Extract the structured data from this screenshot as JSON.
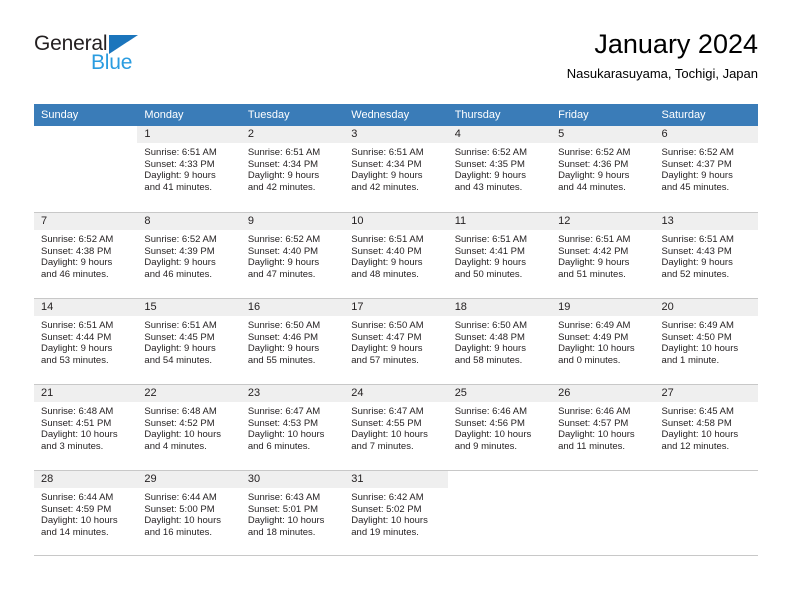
{
  "brand": {
    "name_part1": "General",
    "name_part2": "Blue",
    "triangle_icon": "triangle-icon",
    "color_dark": "#231f20",
    "color_blue": "#2a9ce0",
    "color_triangle": "#1b75bc"
  },
  "header": {
    "title": "January 2024",
    "subtitle": "Nasukarasuyama, Tochigi, Japan"
  },
  "calendar": {
    "header_bg": "#3a7cb8",
    "daynum_bg": "#efefef",
    "weekdays": [
      "Sunday",
      "Monday",
      "Tuesday",
      "Wednesday",
      "Thursday",
      "Friday",
      "Saturday"
    ],
    "weeks": [
      [
        {
          "day": "",
          "lines": []
        },
        {
          "day": "1",
          "lines": [
            "Sunrise: 6:51 AM",
            "Sunset: 4:33 PM",
            "Daylight: 9 hours",
            "and 41 minutes."
          ]
        },
        {
          "day": "2",
          "lines": [
            "Sunrise: 6:51 AM",
            "Sunset: 4:34 PM",
            "Daylight: 9 hours",
            "and 42 minutes."
          ]
        },
        {
          "day": "3",
          "lines": [
            "Sunrise: 6:51 AM",
            "Sunset: 4:34 PM",
            "Daylight: 9 hours",
            "and 42 minutes."
          ]
        },
        {
          "day": "4",
          "lines": [
            "Sunrise: 6:52 AM",
            "Sunset: 4:35 PM",
            "Daylight: 9 hours",
            "and 43 minutes."
          ]
        },
        {
          "day": "5",
          "lines": [
            "Sunrise: 6:52 AM",
            "Sunset: 4:36 PM",
            "Daylight: 9 hours",
            "and 44 minutes."
          ]
        },
        {
          "day": "6",
          "lines": [
            "Sunrise: 6:52 AM",
            "Sunset: 4:37 PM",
            "Daylight: 9 hours",
            "and 45 minutes."
          ]
        }
      ],
      [
        {
          "day": "7",
          "lines": [
            "Sunrise: 6:52 AM",
            "Sunset: 4:38 PM",
            "Daylight: 9 hours",
            "and 46 minutes."
          ]
        },
        {
          "day": "8",
          "lines": [
            "Sunrise: 6:52 AM",
            "Sunset: 4:39 PM",
            "Daylight: 9 hours",
            "and 46 minutes."
          ]
        },
        {
          "day": "9",
          "lines": [
            "Sunrise: 6:52 AM",
            "Sunset: 4:40 PM",
            "Daylight: 9 hours",
            "and 47 minutes."
          ]
        },
        {
          "day": "10",
          "lines": [
            "Sunrise: 6:51 AM",
            "Sunset: 4:40 PM",
            "Daylight: 9 hours",
            "and 48 minutes."
          ]
        },
        {
          "day": "11",
          "lines": [
            "Sunrise: 6:51 AM",
            "Sunset: 4:41 PM",
            "Daylight: 9 hours",
            "and 50 minutes."
          ]
        },
        {
          "day": "12",
          "lines": [
            "Sunrise: 6:51 AM",
            "Sunset: 4:42 PM",
            "Daylight: 9 hours",
            "and 51 minutes."
          ]
        },
        {
          "day": "13",
          "lines": [
            "Sunrise: 6:51 AM",
            "Sunset: 4:43 PM",
            "Daylight: 9 hours",
            "and 52 minutes."
          ]
        }
      ],
      [
        {
          "day": "14",
          "lines": [
            "Sunrise: 6:51 AM",
            "Sunset: 4:44 PM",
            "Daylight: 9 hours",
            "and 53 minutes."
          ]
        },
        {
          "day": "15",
          "lines": [
            "Sunrise: 6:51 AM",
            "Sunset: 4:45 PM",
            "Daylight: 9 hours",
            "and 54 minutes."
          ]
        },
        {
          "day": "16",
          "lines": [
            "Sunrise: 6:50 AM",
            "Sunset: 4:46 PM",
            "Daylight: 9 hours",
            "and 55 minutes."
          ]
        },
        {
          "day": "17",
          "lines": [
            "Sunrise: 6:50 AM",
            "Sunset: 4:47 PM",
            "Daylight: 9 hours",
            "and 57 minutes."
          ]
        },
        {
          "day": "18",
          "lines": [
            "Sunrise: 6:50 AM",
            "Sunset: 4:48 PM",
            "Daylight: 9 hours",
            "and 58 minutes."
          ]
        },
        {
          "day": "19",
          "lines": [
            "Sunrise: 6:49 AM",
            "Sunset: 4:49 PM",
            "Daylight: 10 hours",
            "and 0 minutes."
          ]
        },
        {
          "day": "20",
          "lines": [
            "Sunrise: 6:49 AM",
            "Sunset: 4:50 PM",
            "Daylight: 10 hours",
            "and 1 minute."
          ]
        }
      ],
      [
        {
          "day": "21",
          "lines": [
            "Sunrise: 6:48 AM",
            "Sunset: 4:51 PM",
            "Daylight: 10 hours",
            "and 3 minutes."
          ]
        },
        {
          "day": "22",
          "lines": [
            "Sunrise: 6:48 AM",
            "Sunset: 4:52 PM",
            "Daylight: 10 hours",
            "and 4 minutes."
          ]
        },
        {
          "day": "23",
          "lines": [
            "Sunrise: 6:47 AM",
            "Sunset: 4:53 PM",
            "Daylight: 10 hours",
            "and 6 minutes."
          ]
        },
        {
          "day": "24",
          "lines": [
            "Sunrise: 6:47 AM",
            "Sunset: 4:55 PM",
            "Daylight: 10 hours",
            "and 7 minutes."
          ]
        },
        {
          "day": "25",
          "lines": [
            "Sunrise: 6:46 AM",
            "Sunset: 4:56 PM",
            "Daylight: 10 hours",
            "and 9 minutes."
          ]
        },
        {
          "day": "26",
          "lines": [
            "Sunrise: 6:46 AM",
            "Sunset: 4:57 PM",
            "Daylight: 10 hours",
            "and 11 minutes."
          ]
        },
        {
          "day": "27",
          "lines": [
            "Sunrise: 6:45 AM",
            "Sunset: 4:58 PM",
            "Daylight: 10 hours",
            "and 12 minutes."
          ]
        }
      ],
      [
        {
          "day": "28",
          "lines": [
            "Sunrise: 6:44 AM",
            "Sunset: 4:59 PM",
            "Daylight: 10 hours",
            "and 14 minutes."
          ]
        },
        {
          "day": "29",
          "lines": [
            "Sunrise: 6:44 AM",
            "Sunset: 5:00 PM",
            "Daylight: 10 hours",
            "and 16 minutes."
          ]
        },
        {
          "day": "30",
          "lines": [
            "Sunrise: 6:43 AM",
            "Sunset: 5:01 PM",
            "Daylight: 10 hours",
            "and 18 minutes."
          ]
        },
        {
          "day": "31",
          "lines": [
            "Sunrise: 6:42 AM",
            "Sunset: 5:02 PM",
            "Daylight: 10 hours",
            "and 19 minutes."
          ]
        },
        {
          "day": "",
          "lines": []
        },
        {
          "day": "",
          "lines": []
        },
        {
          "day": "",
          "lines": []
        }
      ]
    ]
  }
}
